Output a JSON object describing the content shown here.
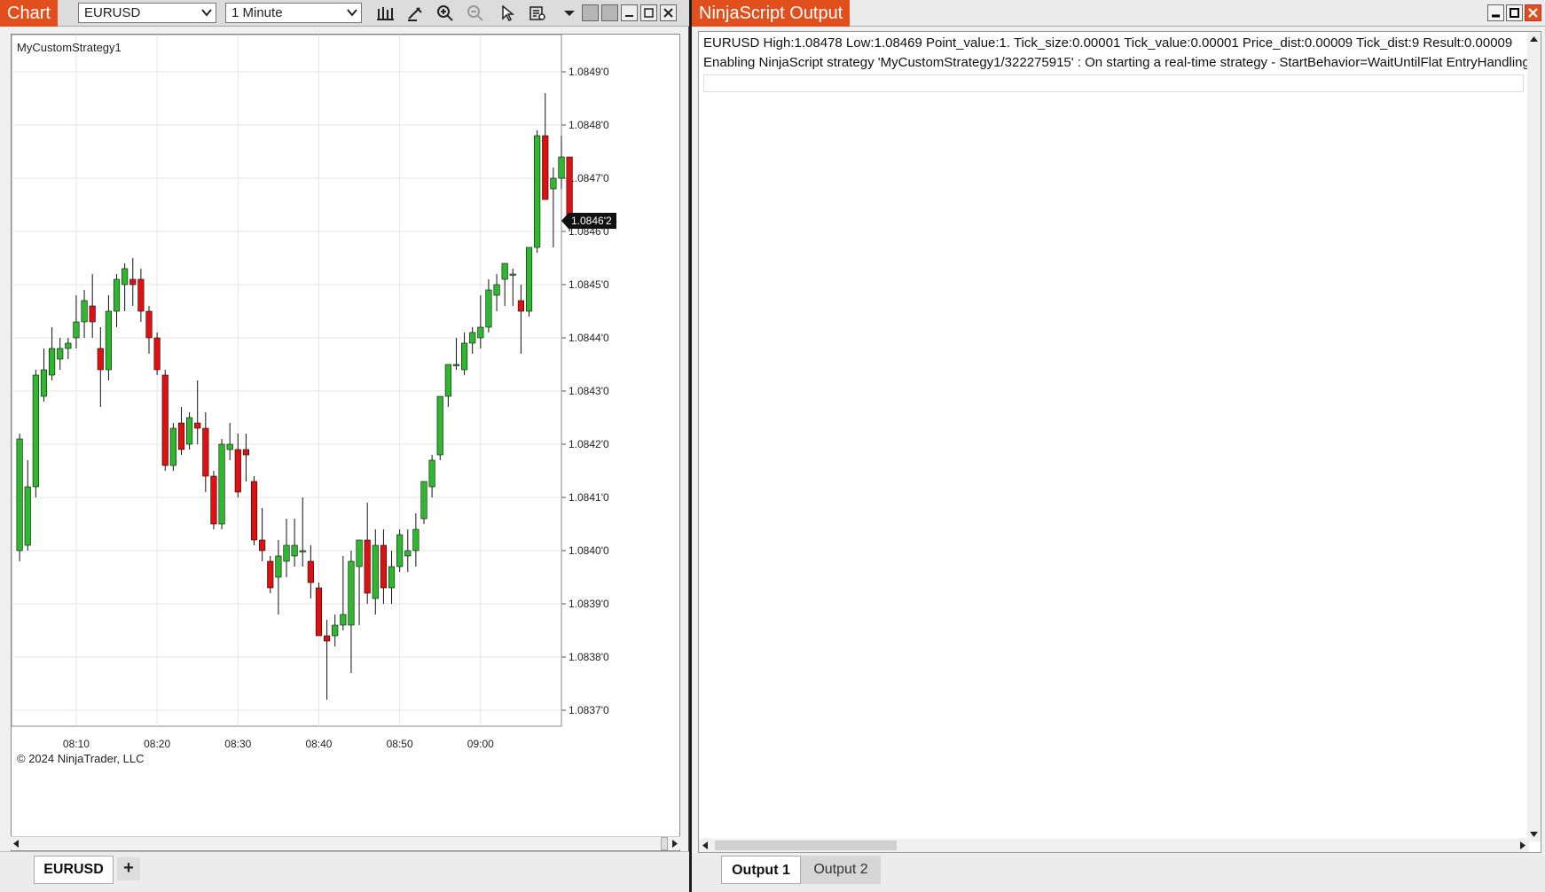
{
  "chart_window": {
    "title": "Chart",
    "instrument": "EURUSD",
    "interval": "1 Minute",
    "strategy_label": "MyCustomStrategy1",
    "copyright": "© 2024 NinjaTrader, LLC",
    "tab_label": "EURUSD",
    "add_tab_label": "+",
    "colors": {
      "up": "#2eb82e",
      "down": "#e01010",
      "accent": "#e04f1c"
    }
  },
  "output_window": {
    "title": "NinjaScript Output",
    "lines": [
      "EURUSD   High:1.08478   Low:1.08469   Point_value:1.   Tick_size:0.00001   Tick_value:0.00001   Price_dist:0.00009   Tick_dist:9   Result:0.00009",
      "Enabling NinjaScript strategy 'MyCustomStrategy1/322275915' : On starting a real-time strategy - StartBehavior=WaitUntilFlat EntryHandling"
    ],
    "tabs": [
      "Output 1",
      "Output 2"
    ]
  },
  "chart_data": {
    "type": "candlestick",
    "ylim": [
      1.08367,
      1.08497
    ],
    "y_ticks": [
      "1.0849'0",
      "1.0848'0",
      "1.0847'0",
      "1.0846'0",
      "1.0845'0",
      "1.0844'0",
      "1.0843'0",
      "1.0842'0",
      "1.0841'0",
      "1.0840'0",
      "1.0839'0",
      "1.0838'0",
      "1.0837'0"
    ],
    "y_tick_values": [
      1.0849,
      1.0848,
      1.0847,
      1.0846,
      1.0845,
      1.0844,
      1.0843,
      1.0842,
      1.0841,
      1.084,
      1.0839,
      1.0838,
      1.0837
    ],
    "x_ticks": [
      "08:10",
      "08:20",
      "08:30",
      "08:40",
      "08:50",
      "09:00"
    ],
    "x_tick_minutes": [
      10,
      20,
      30,
      40,
      50,
      60
    ],
    "x_start_minute": 2,
    "x_end_minute": 70,
    "current_price_label": "1.0846'2",
    "current_price": 1.08462,
    "candles": [
      {
        "o": 1.084,
        "h": 1.08422,
        "l": 1.08398,
        "c": 1.08421
      },
      {
        "o": 1.08401,
        "h": 1.08417,
        "l": 1.084,
        "c": 1.08412
      },
      {
        "o": 1.08412,
        "h": 1.08434,
        "l": 1.0841,
        "c": 1.08433
      },
      {
        "o": 1.08429,
        "h": 1.08438,
        "l": 1.08428,
        "c": 1.08434
      },
      {
        "o": 1.08433,
        "h": 1.08442,
        "l": 1.08432,
        "c": 1.08438
      },
      {
        "o": 1.08436,
        "h": 1.0844,
        "l": 1.08434,
        "c": 1.08438
      },
      {
        "o": 1.08438,
        "h": 1.0844,
        "l": 1.08436,
        "c": 1.08439
      },
      {
        "o": 1.0844,
        "h": 1.08448,
        "l": 1.08438,
        "c": 1.08443
      },
      {
        "o": 1.08443,
        "h": 1.08449,
        "l": 1.0844,
        "c": 1.08447
      },
      {
        "o": 1.08446,
        "h": 1.08452,
        "l": 1.0844,
        "c": 1.08443
      },
      {
        "o": 1.08438,
        "h": 1.08442,
        "l": 1.08427,
        "c": 1.08434
      },
      {
        "o": 1.08434,
        "h": 1.08448,
        "l": 1.08432,
        "c": 1.08445
      },
      {
        "o": 1.08445,
        "h": 1.08452,
        "l": 1.08442,
        "c": 1.08451
      },
      {
        "o": 1.0845,
        "h": 1.08454,
        "l": 1.08445,
        "c": 1.08453
      },
      {
        "o": 1.08451,
        "h": 1.08455,
        "l": 1.08446,
        "c": 1.0845
      },
      {
        "o": 1.08451,
        "h": 1.08453,
        "l": 1.08443,
        "c": 1.08445
      },
      {
        "o": 1.08445,
        "h": 1.08446,
        "l": 1.08437,
        "c": 1.0844
      },
      {
        "o": 1.0844,
        "h": 1.08441,
        "l": 1.08433,
        "c": 1.08434
      },
      {
        "o": 1.08433,
        "h": 1.08434,
        "l": 1.08415,
        "c": 1.08416
      },
      {
        "o": 1.08416,
        "h": 1.08424,
        "l": 1.08415,
        "c": 1.08423
      },
      {
        "o": 1.08424,
        "h": 1.08427,
        "l": 1.08418,
        "c": 1.08419
      },
      {
        "o": 1.0842,
        "h": 1.08426,
        "l": 1.08419,
        "c": 1.08425
      },
      {
        "o": 1.08424,
        "h": 1.08432,
        "l": 1.0842,
        "c": 1.08423
      },
      {
        "o": 1.08423,
        "h": 1.08426,
        "l": 1.08411,
        "c": 1.08414
      },
      {
        "o": 1.08414,
        "h": 1.08415,
        "l": 1.08404,
        "c": 1.08405
      },
      {
        "o": 1.08405,
        "h": 1.08421,
        "l": 1.08404,
        "c": 1.0842
      },
      {
        "o": 1.08419,
        "h": 1.08424,
        "l": 1.08417,
        "c": 1.0842
      },
      {
        "o": 1.08419,
        "h": 1.08422,
        "l": 1.0841,
        "c": 1.08411
      },
      {
        "o": 1.08419,
        "h": 1.08422,
        "l": 1.08413,
        "c": 1.08418
      },
      {
        "o": 1.08413,
        "h": 1.08414,
        "l": 1.08401,
        "c": 1.08402
      },
      {
        "o": 1.08402,
        "h": 1.08408,
        "l": 1.08398,
        "c": 1.084
      },
      {
        "o": 1.08398,
        "h": 1.08399,
        "l": 1.08392,
        "c": 1.08393
      },
      {
        "o": 1.08395,
        "h": 1.08402,
        "l": 1.08388,
        "c": 1.08399
      },
      {
        "o": 1.08398,
        "h": 1.08406,
        "l": 1.08395,
        "c": 1.08401
      },
      {
        "o": 1.08399,
        "h": 1.08406,
        "l": 1.08397,
        "c": 1.08401
      },
      {
        "o": 1.084,
        "h": 1.0841,
        "l": 1.08397,
        "c": 1.084
      },
      {
        "o": 1.08398,
        "h": 1.08401,
        "l": 1.08391,
        "c": 1.08394
      },
      {
        "o": 1.08393,
        "h": 1.08394,
        "l": 1.08384,
        "c": 1.08384
      },
      {
        "o": 1.08384,
        "h": 1.08387,
        "l": 1.08372,
        "c": 1.08383
      },
      {
        "o": 1.08384,
        "h": 1.08388,
        "l": 1.08382,
        "c": 1.08386
      },
      {
        "o": 1.08386,
        "h": 1.08399,
        "l": 1.08385,
        "c": 1.08388
      },
      {
        "o": 1.08386,
        "h": 1.084,
        "l": 1.08377,
        "c": 1.08398
      },
      {
        "o": 1.08397,
        "h": 1.08402,
        "l": 1.08386,
        "c": 1.08402
      },
      {
        "o": 1.08402,
        "h": 1.08409,
        "l": 1.0839,
        "c": 1.08392
      },
      {
        "o": 1.08391,
        "h": 1.08404,
        "l": 1.08388,
        "c": 1.08401
      },
      {
        "o": 1.08401,
        "h": 1.08404,
        "l": 1.0839,
        "c": 1.08393
      },
      {
        "o": 1.08393,
        "h": 1.084,
        "l": 1.0839,
        "c": 1.08397
      },
      {
        "o": 1.08397,
        "h": 1.08404,
        "l": 1.08396,
        "c": 1.08403
      },
      {
        "o": 1.08399,
        "h": 1.08404,
        "l": 1.08396,
        "c": 1.084
      },
      {
        "o": 1.084,
        "h": 1.08407,
        "l": 1.08397,
        "c": 1.08404
      },
      {
        "o": 1.08406,
        "h": 1.08413,
        "l": 1.08405,
        "c": 1.08413
      },
      {
        "o": 1.08412,
        "h": 1.08418,
        "l": 1.0841,
        "c": 1.08417
      },
      {
        "o": 1.08418,
        "h": 1.08429,
        "l": 1.08417,
        "c": 1.08429
      },
      {
        "o": 1.08429,
        "h": 1.08435,
        "l": 1.08427,
        "c": 1.08435
      },
      {
        "o": 1.08435,
        "h": 1.0844,
        "l": 1.08434,
        "c": 1.08435
      },
      {
        "o": 1.08434,
        "h": 1.08441,
        "l": 1.08433,
        "c": 1.08439
      },
      {
        "o": 1.08439,
        "h": 1.08442,
        "l": 1.08437,
        "c": 1.08441
      },
      {
        "o": 1.0844,
        "h": 1.08448,
        "l": 1.08438,
        "c": 1.08442
      },
      {
        "o": 1.08442,
        "h": 1.08451,
        "l": 1.08441,
        "c": 1.08449
      },
      {
        "o": 1.08448,
        "h": 1.08452,
        "l": 1.08445,
        "c": 1.0845
      },
      {
        "o": 1.08451,
        "h": 1.08454,
        "l": 1.08446,
        "c": 1.08454
      },
      {
        "o": 1.08452,
        "h": 1.08453,
        "l": 1.08446,
        "c": 1.08452
      },
      {
        "o": 1.08447,
        "h": 1.0845,
        "l": 1.08437,
        "c": 1.08445
      },
      {
        "o": 1.08445,
        "h": 1.08457,
        "l": 1.08444,
        "c": 1.08457
      },
      {
        "o": 1.08457,
        "h": 1.08479,
        "l": 1.08456,
        "c": 1.08478
      },
      {
        "o": 1.08478,
        "h": 1.08486,
        "l": 1.08467,
        "c": 1.08466
      },
      {
        "o": 1.08468,
        "h": 1.08472,
        "l": 1.08457,
        "c": 1.0847
      },
      {
        "o": 1.0847,
        "h": 1.08478,
        "l": 1.08468,
        "c": 1.08474
      },
      {
        "o": 1.08474,
        "h": 1.08474,
        "l": 1.0846,
        "c": 1.08462
      }
    ]
  }
}
